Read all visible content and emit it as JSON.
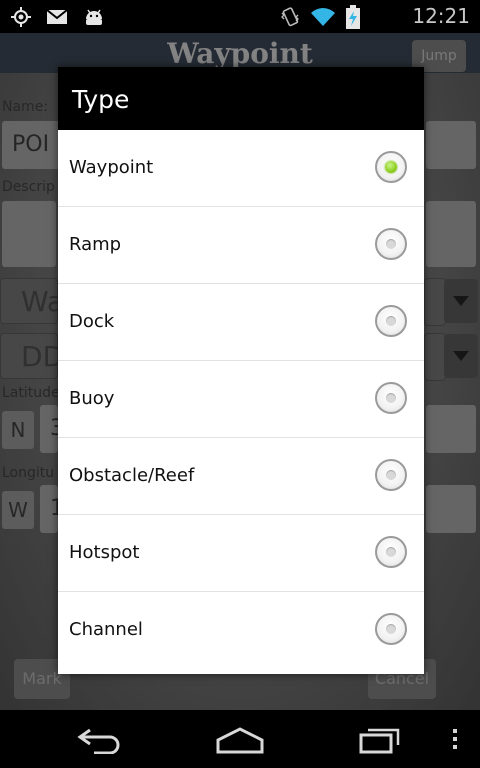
{
  "status_bar": {
    "time": "12:21",
    "left_icons": [
      "gps-icon",
      "gmail-icon",
      "android-icon"
    ],
    "right_icons": [
      "vibrate-icon",
      "wifi-icon",
      "battery-charging-icon"
    ]
  },
  "background_screen": {
    "title": "Waypoint",
    "jump_button": "Jump",
    "name_label": "Name:",
    "name_value": "POI",
    "description_label": "Descrip",
    "type_dropdown": "Wa",
    "format_dropdown": "DD",
    "latitude_label": "Latitude",
    "latitude_hemisphere": "N",
    "latitude_value": "3",
    "longitude_label": "Longitu",
    "longitude_hemisphere": "W",
    "longitude_value": "1",
    "mark_button": "Mark",
    "cancel_button": "Cancel"
  },
  "dialog": {
    "title": "Type",
    "options": [
      {
        "label": "Waypoint",
        "selected": true
      },
      {
        "label": "Ramp",
        "selected": false
      },
      {
        "label": "Dock",
        "selected": false
      },
      {
        "label": "Buoy",
        "selected": false
      },
      {
        "label": "Obstacle/Reef",
        "selected": false
      },
      {
        "label": "Hotspot",
        "selected": false
      },
      {
        "label": "Channel",
        "selected": false
      }
    ]
  },
  "nav_bar": {
    "buttons": [
      "back-icon",
      "home-icon",
      "recent-apps-icon",
      "menu-icon"
    ]
  },
  "colors": {
    "selected_radio": "#8fcf1f",
    "dialog_title_bg": "#000000"
  }
}
